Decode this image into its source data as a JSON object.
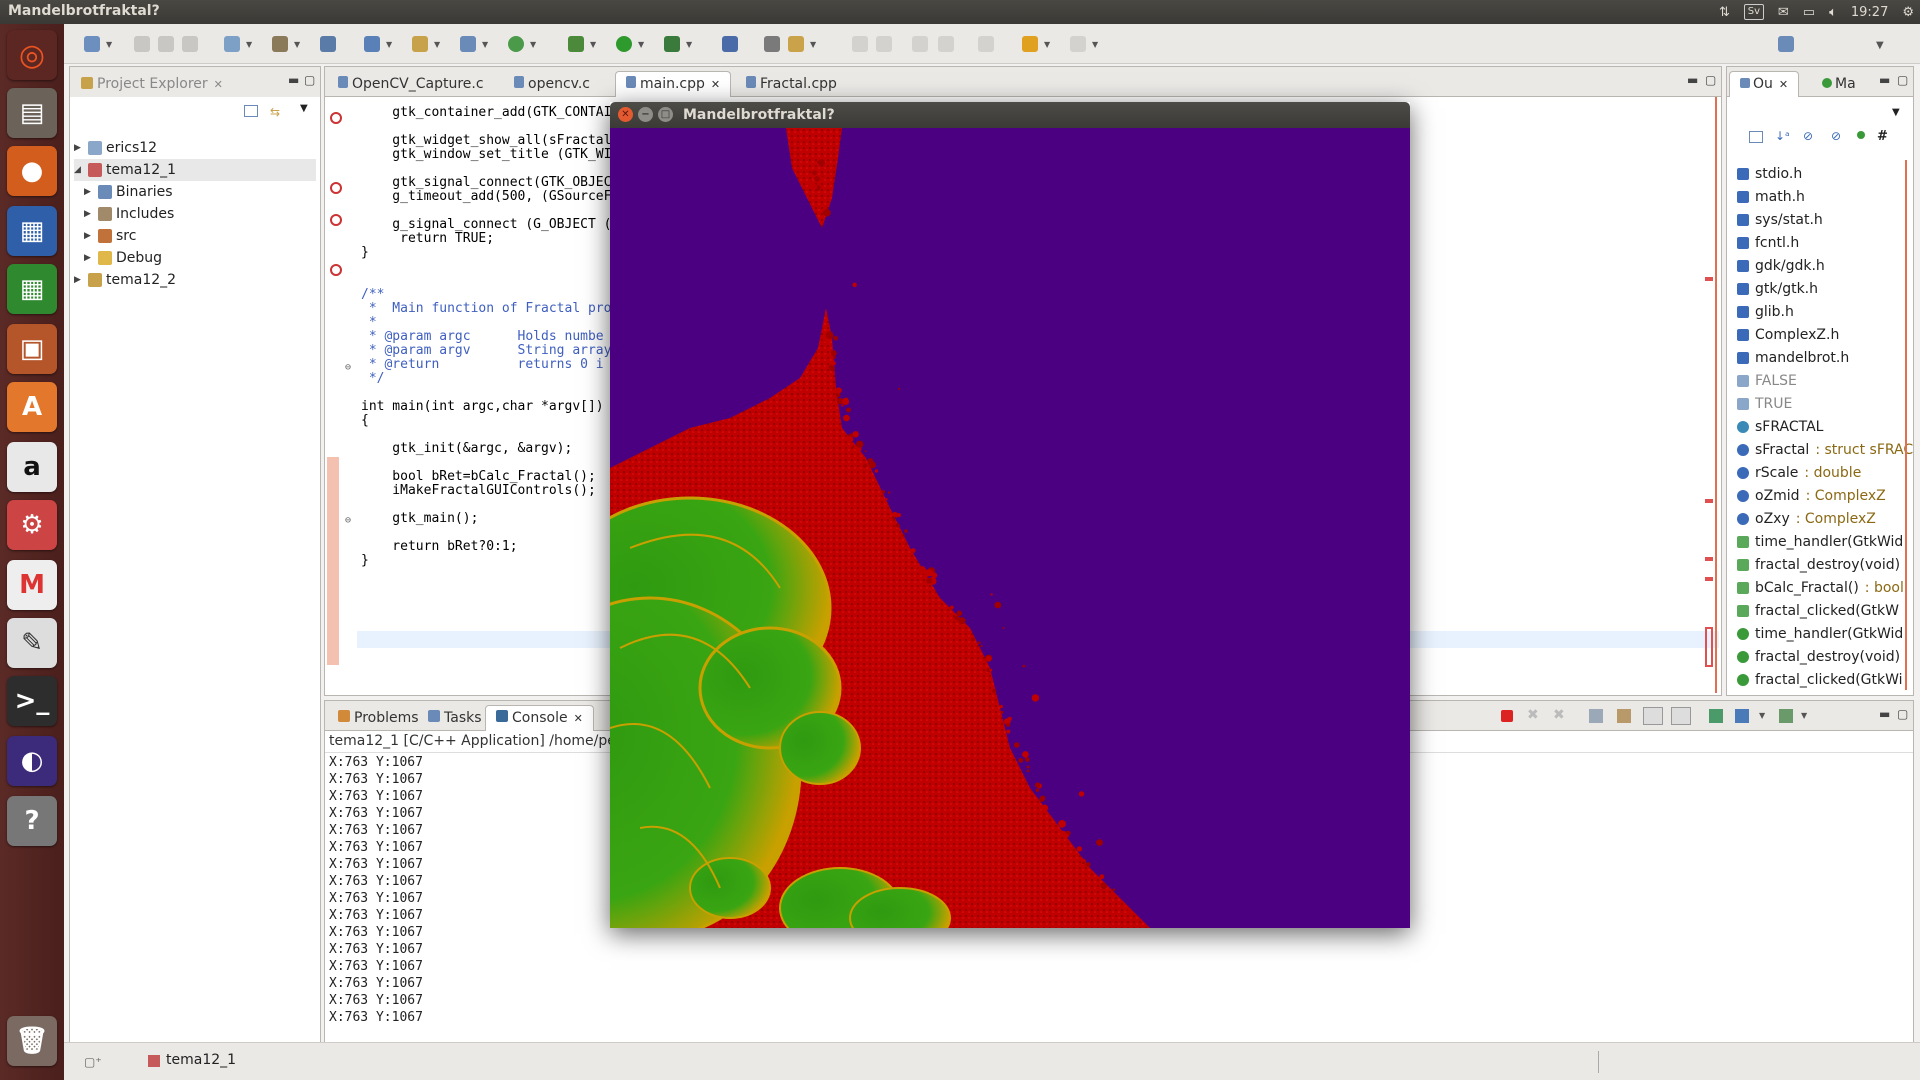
{
  "topbar": {
    "title": "Mandelbrotfraktal?",
    "lang": "Sv",
    "time": "19:27"
  },
  "launcher": {
    "items": [
      "ubuntu-dash",
      "files",
      "firefox",
      "writer",
      "calc",
      "impress",
      "software-center",
      "amazon",
      "system-settings",
      "gmail",
      "text-editor",
      "terminal",
      "eclipse",
      "help",
      "trash"
    ]
  },
  "project_explorer": {
    "title": "Project Explorer",
    "items": [
      {
        "label": "erics12",
        "level": 0,
        "expanded": false
      },
      {
        "label": "tema12_1",
        "level": 0,
        "expanded": true
      },
      {
        "label": "Binaries",
        "level": 1,
        "expanded": false
      },
      {
        "label": "Includes",
        "level": 1,
        "expanded": false
      },
      {
        "label": "src",
        "level": 1,
        "expanded": false
      },
      {
        "label": "Debug",
        "level": 1,
        "expanded": false
      },
      {
        "label": "tema12_2",
        "level": 0,
        "expanded": false
      }
    ]
  },
  "editor": {
    "tabs": [
      {
        "label": "OpenCV_Capture.c",
        "active": false
      },
      {
        "label": "opencv.c",
        "active": false
      },
      {
        "label": "main.cpp",
        "active": true
      },
      {
        "label": "Fractal.cpp",
        "active": false
      }
    ],
    "lines": [
      "    gtk_container_add(GTK_CONTAINER",
      "",
      "    gtk_widget_show_all(sFractal.",
      "    gtk_window_set_title (GTK_WIND",
      "",
      "    gtk_signal_connect(GTK_OBJECT",
      "    g_timeout_add(500, (GSourceFun",
      "",
      "    g_signal_connect (G_OBJECT (pl",
      "     return TRUE;",
      "}",
      "",
      "",
      "/**",
      " *  Main function of Fractal pro",
      " *",
      " * @param argc      Holds numbe",
      " * @param argv      String array",
      " * @return          returns 0 i",
      " */",
      "",
      "int main(int argc,char *argv[])",
      "{",
      "",
      "    gtk_init(&argc, &argv);",
      "",
      "    bool bRet=bCalc_Fractal();",
      "    iMakeFractalGUIControls();",
      "",
      "    gtk_main();",
      "",
      "    return bRet?0:1;",
      "}"
    ]
  },
  "outline": {
    "tabs": [
      {
        "label": "Ou"
      },
      {
        "label": "Ma"
      }
    ],
    "items": [
      {
        "label": "stdio.h",
        "type": ""
      },
      {
        "label": "math.h",
        "type": ""
      },
      {
        "label": "sys/stat.h",
        "type": ""
      },
      {
        "label": "fcntl.h",
        "type": ""
      },
      {
        "label": "gdk/gdk.h",
        "type": ""
      },
      {
        "label": "gtk/gtk.h",
        "type": ""
      },
      {
        "label": "glib.h",
        "type": ""
      },
      {
        "label": "ComplexZ.h",
        "type": ""
      },
      {
        "label": "mandelbrot.h",
        "type": ""
      },
      {
        "label": "FALSE",
        "type": ""
      },
      {
        "label": "TRUE",
        "type": ""
      },
      {
        "label": "sFRACTAL",
        "type": ""
      },
      {
        "label": "sFractal",
        "type": " : struct sFRAC"
      },
      {
        "label": "rScale",
        "type": " : double"
      },
      {
        "label": "oZmid",
        "type": " : ComplexZ"
      },
      {
        "label": "oZxy",
        "type": " : ComplexZ"
      },
      {
        "label": "time_handler(GtkWid",
        "type": ""
      },
      {
        "label": "fractal_destroy(void)",
        "type": ""
      },
      {
        "label": "bCalc_Fractal()",
        "type": " : bool"
      },
      {
        "label": "fractal_clicked(GtkW",
        "type": ""
      },
      {
        "label": "time_handler(GtkWid",
        "type": ""
      },
      {
        "label": "fractal_destroy(void)",
        "type": ""
      },
      {
        "label": "fractal_clicked(GtkWi",
        "type": ""
      }
    ]
  },
  "console": {
    "tabs": [
      {
        "label": "Problems"
      },
      {
        "label": "Tasks"
      },
      {
        "label": "Console"
      }
    ],
    "path": "tema12_1 [C/C++ Application] /home/pett",
    "lines": [
      "X:763 Y:1067",
      "X:763 Y:1067",
      "X:763 Y:1067",
      "X:763 Y:1067",
      "X:763 Y:1067",
      "X:763 Y:1067",
      "X:763 Y:1067",
      "X:763 Y:1067",
      "X:763 Y:1067",
      "X:763 Y:1067",
      "X:763 Y:1067",
      "X:763 Y:1067",
      "X:763 Y:1067",
      "X:763 Y:1067",
      "X:763 Y:1067",
      "X:763 Y:1067"
    ]
  },
  "fractal_window": {
    "title": "Mandelbrotfraktal?",
    "colors": {
      "background": "#4a0080",
      "boundary": "#cc0000",
      "interior": "#2f9a10",
      "interior_edge": "#c8a000"
    }
  },
  "statusbar": {
    "project": "tema12_1"
  }
}
